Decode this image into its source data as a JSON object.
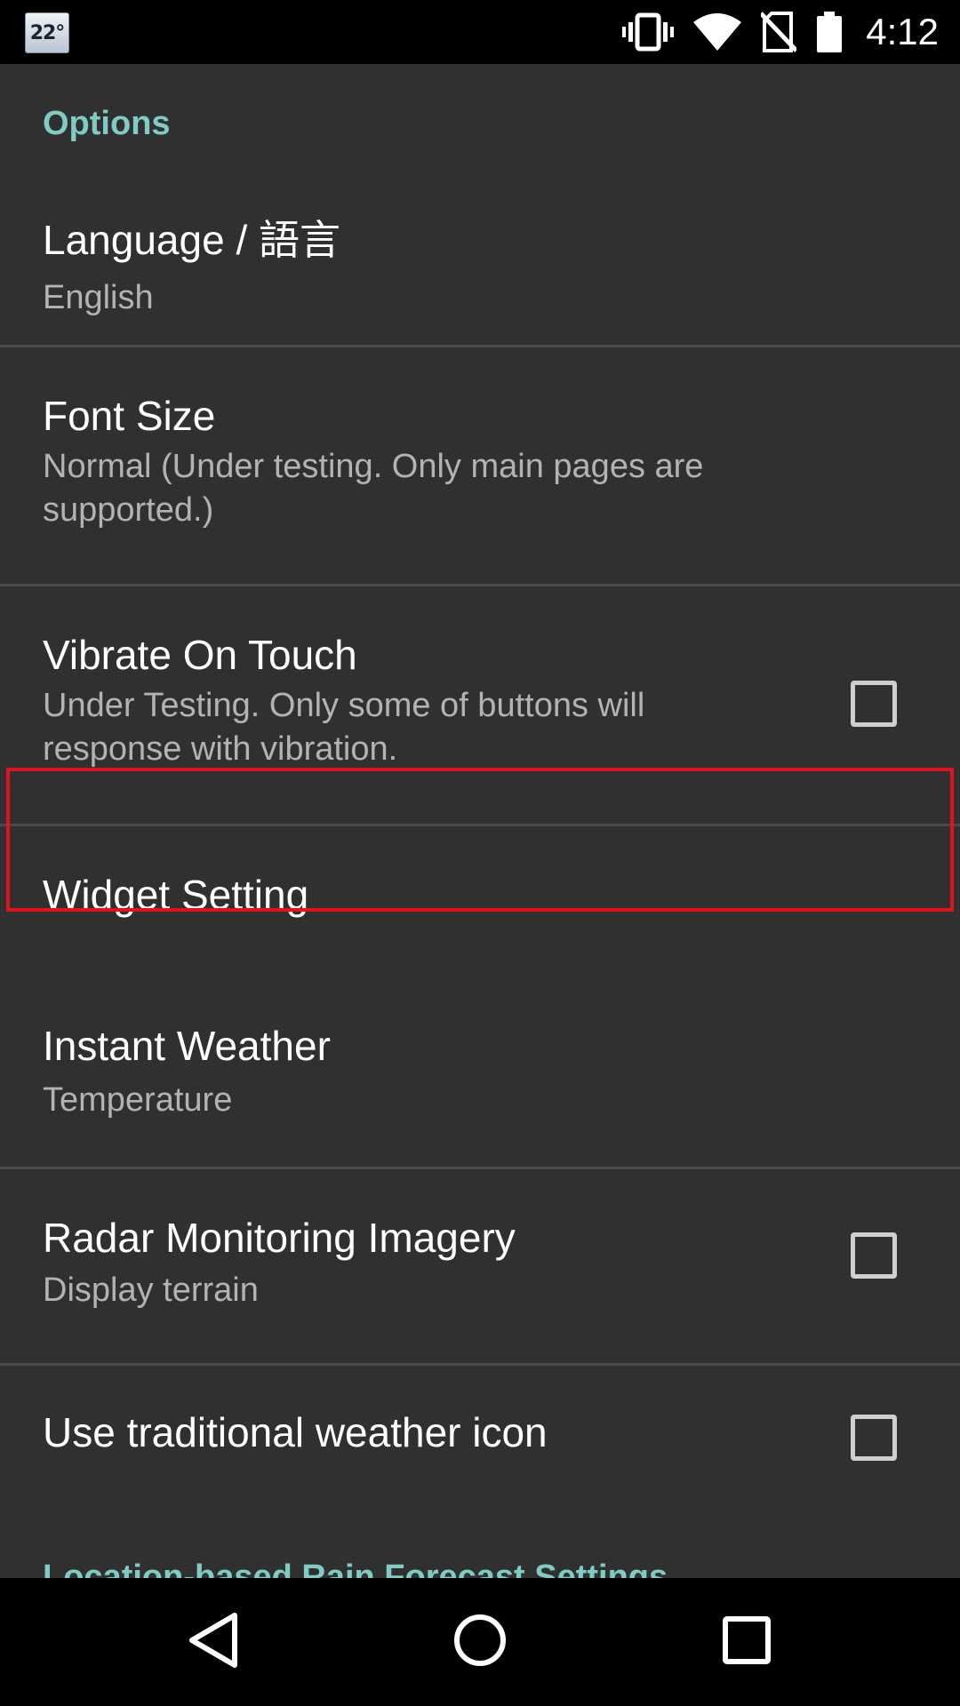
{
  "status_bar": {
    "temperature_badge": "22°",
    "time": "4:12",
    "icons": [
      "vibrate-icon",
      "wifi-icon",
      "no-sim-icon",
      "battery-icon"
    ]
  },
  "settings": {
    "category_options": "Options",
    "language": {
      "title": "Language / 語言",
      "summary": "English"
    },
    "font_size": {
      "title": "Font Size",
      "summary": "Normal (Under testing. Only main pages are supported.)"
    },
    "vibrate": {
      "title": "Vibrate On Touch",
      "summary": "Under Testing. Only some of buttons will response with vibration.",
      "checked": false
    },
    "widget": {
      "title": "Widget Setting"
    },
    "instant_weather": {
      "title": "Instant Weather",
      "summary": "Temperature"
    },
    "radar": {
      "title": "Radar Monitoring Imagery",
      "summary": "Display terrain",
      "checked": false
    },
    "traditional_icon": {
      "title": "Use traditional weather icon",
      "checked": false
    },
    "category_rain": "Location-based Rain Forecast Settings"
  },
  "nav_bar": {
    "icons": [
      "back-icon",
      "home-icon",
      "recents-icon"
    ]
  },
  "colors": {
    "background": "#303030",
    "accent": "#80cbc4",
    "highlight": "#e0141e"
  }
}
